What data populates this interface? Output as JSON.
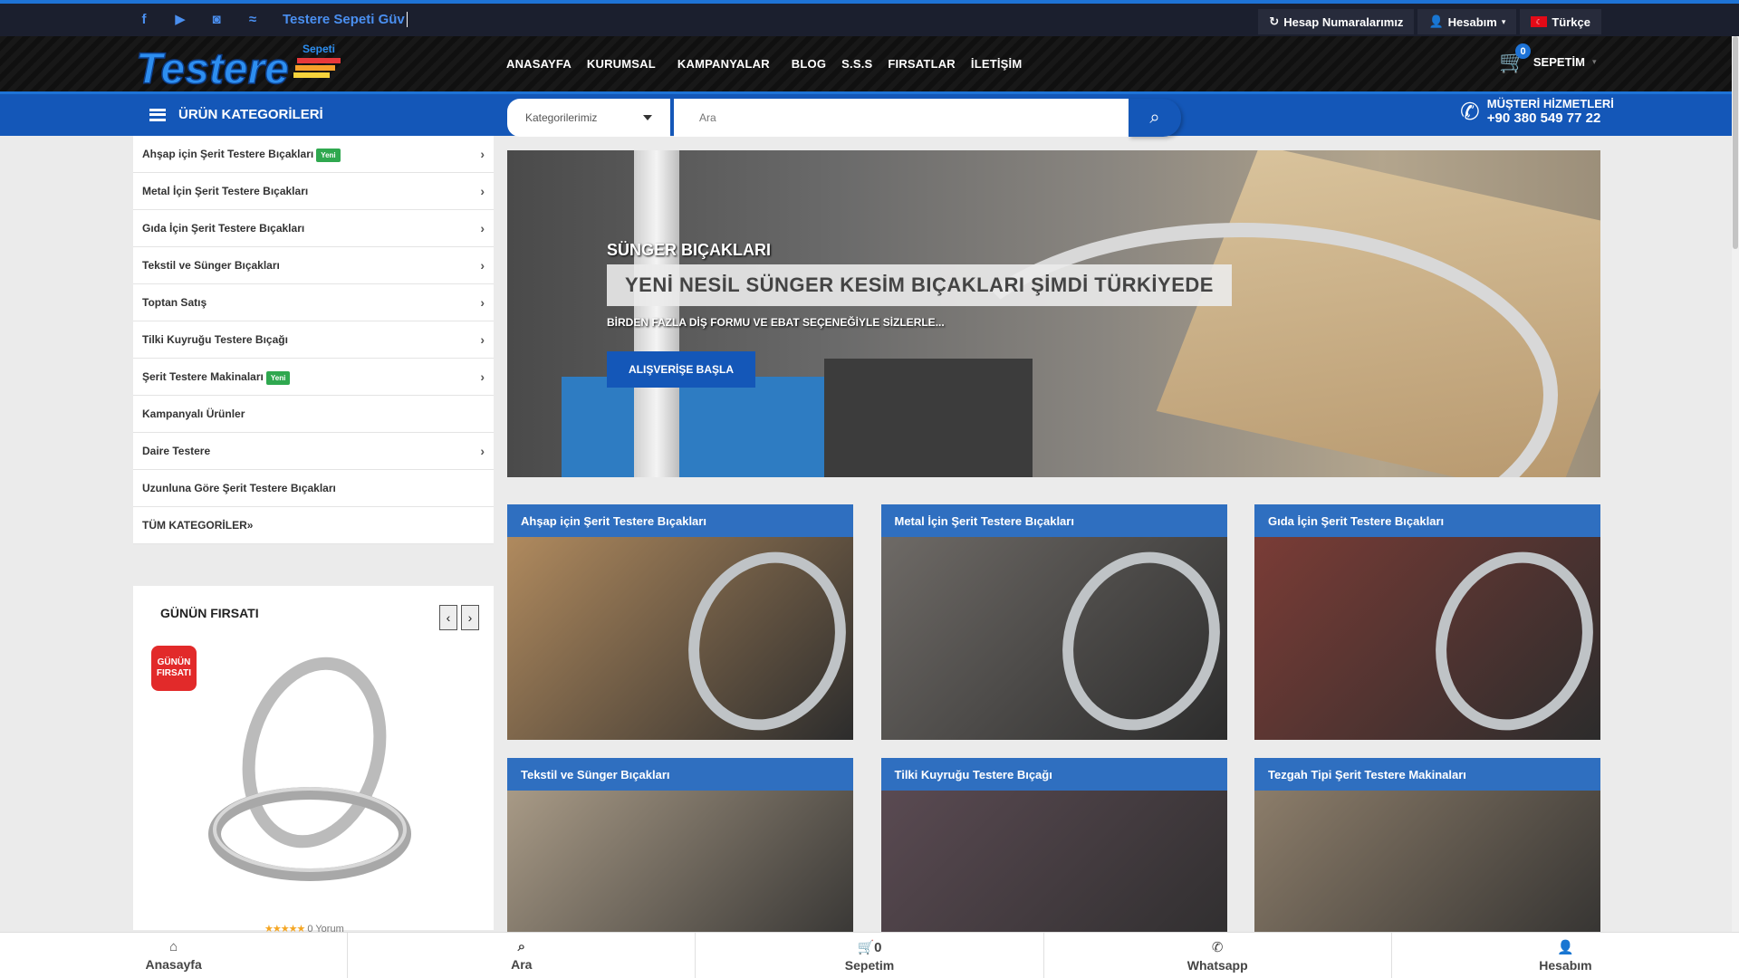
{
  "topbar": {
    "ticker_text": "Testere Sepeti Güv",
    "account_numbers": "Hesap Numaralarımız",
    "account": "Hesabım",
    "language": "Türkçe"
  },
  "header": {
    "logo_text": "Testere",
    "logo_sub": "Sepeti",
    "nav": [
      "ANASAYFA",
      "KURUMSAL",
      "KAMPANYALAR",
      "BLOG",
      "S.S.S",
      "FIRSATLAR",
      "İLETİŞİM"
    ],
    "cart_label": "SEPETİM",
    "cart_count": "0"
  },
  "bluebar": {
    "categories_label": "ÜRÜN KATEGORİLERİ",
    "search_select": "Kategorilerimiz",
    "search_placeholder": "Ara",
    "support_title": "MÜŞTERİ HİZMETLERİ",
    "support_phone": "+90 380 549 77 22"
  },
  "sidebar": {
    "items": [
      {
        "label": "Ahşap için Şerit Testere Bıçakları",
        "badge": "Yeni",
        "arrow": true
      },
      {
        "label": "Metal İçin Şerit Testere Bıçakları",
        "badge": "",
        "arrow": true
      },
      {
        "label": "Gıda İçin Şerit Testere Bıçakları",
        "badge": "",
        "arrow": true
      },
      {
        "label": "Tekstil ve Sünger Bıçakları",
        "badge": "",
        "arrow": true
      },
      {
        "label": "Toptan Satış",
        "badge": "",
        "arrow": true
      },
      {
        "label": "Tilki Kuyruğu Testere Bıçağı",
        "badge": "",
        "arrow": true
      },
      {
        "label": "Şerit Testere Makinaları",
        "badge": "Yeni",
        "arrow": true
      },
      {
        "label": "Kampanyalı Ürünler",
        "badge": "",
        "arrow": false
      },
      {
        "label": "Daire Testere",
        "badge": "",
        "arrow": true
      },
      {
        "label": "Uzunluna Göre Şerit Testere Bıçakları",
        "badge": "",
        "arrow": false
      },
      {
        "label": "TÜM KATEGORİLER»",
        "badge": "",
        "arrow": false
      }
    ]
  },
  "deal": {
    "title": "GÜNÜN FIRSATI",
    "badge_line1": "GÜNÜN",
    "badge_line2": "FIRSATI",
    "stars": "★★★★★",
    "reviews": "0 Yorum"
  },
  "hero": {
    "subtitle": "SÜNGER BIÇAKLARI",
    "title": "YENİ NESİL SÜNGER KESİM BIÇAKLARI ŞİMDİ TÜRKİYEDE",
    "description": "BİRDEN FAZLA DİŞ FORMU VE EBAT SEÇENEĞİYLE SİZLERLE...",
    "button": "ALIŞVERİŞE BAŞLA"
  },
  "tiles": [
    {
      "title": "Ahşap için Şerit Testere Bıçakları",
      "bg": "#b08a5e"
    },
    {
      "title": "Metal İçin Şerit Testere Bıçakları",
      "bg": "#6e6a66"
    },
    {
      "title": "Gıda İçin Şerit Testere Bıçakları",
      "bg": "#7a3c36"
    },
    {
      "title": "Tekstil ve Sünger Bıçakları",
      "bg": "#a89a86"
    },
    {
      "title": "Tilki Kuyruğu Testere Bıçağı",
      "bg": "#5a4a52"
    },
    {
      "title": "Tezgah Tipi Şerit Testere Makinaları",
      "bg": "#8c7d6a"
    }
  ],
  "bottomnav": {
    "home": "Anasayfa",
    "search": "Ara",
    "cart": "Sepetim",
    "cart_count": "0",
    "whatsapp": "Whatsapp",
    "account": "Hesabım"
  }
}
